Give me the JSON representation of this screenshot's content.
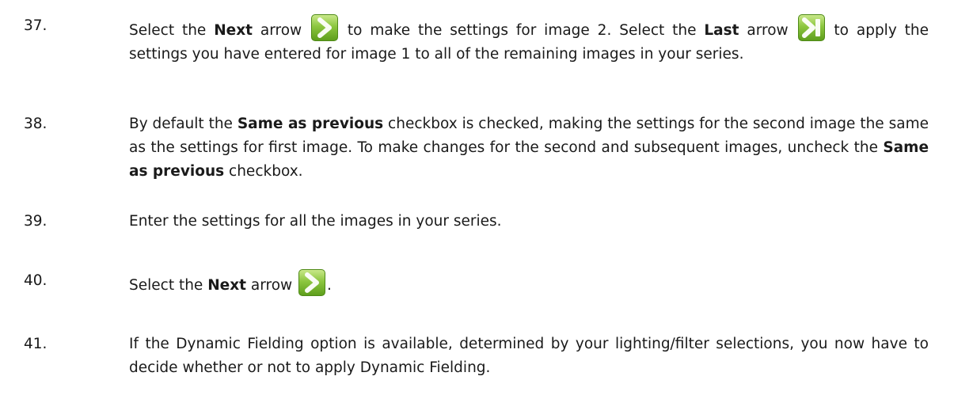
{
  "steps": [
    {
      "number": "37.",
      "t1": "Select the ",
      "b1": "Next",
      "t2": " arrow ",
      "icon1": "next-arrow-icon",
      "t3": " to make the settings for image 2. Select the ",
      "b2": "Last",
      "t4": " arrow ",
      "icon2": "last-arrow-icon",
      "t5": " to apply the settings you have entered for image 1 to all of the remaining images in your series."
    },
    {
      "number": "38.",
      "t1": "By default the ",
      "b1": "Same as previous",
      "t2": " checkbox is checked, making the settings for the second image the same as the settings for first image. To make changes for the second and subsequent images, uncheck the ",
      "b2": "Same as previous",
      "t3": " checkbox."
    },
    {
      "number": "39.",
      "t1": "Enter the settings for all the images in your series."
    },
    {
      "number": "40.",
      "t1": "Select the ",
      "b1": "Next",
      "t2": " arrow ",
      "icon1": "next-arrow-icon",
      "t3": "."
    },
    {
      "number": "41.",
      "t1": "If the Dynamic Fielding option is available, determined by your lighting/filter selections, you now have to decide whether or not to apply Dynamic Fielding."
    }
  ],
  "colors": {
    "icon_green": "#7cc530",
    "text": "#1a1a1a"
  }
}
